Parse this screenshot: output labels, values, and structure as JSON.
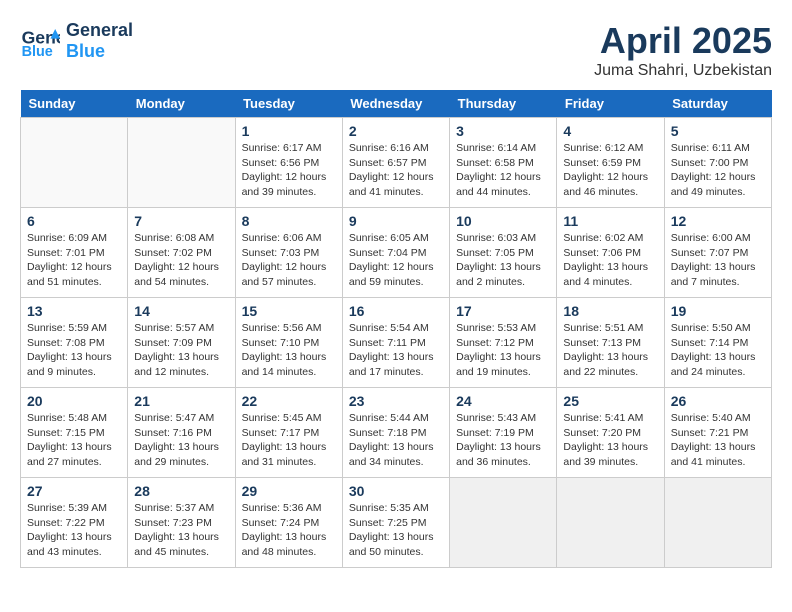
{
  "app": {
    "name": "GeneralBlue"
  },
  "calendar": {
    "month": "April 2025",
    "location": "Juma Shahri, Uzbekistan",
    "weekdays": [
      "Sunday",
      "Monday",
      "Tuesday",
      "Wednesday",
      "Thursday",
      "Friday",
      "Saturday"
    ],
    "weeks": [
      [
        {
          "day": "",
          "info": ""
        },
        {
          "day": "",
          "info": ""
        },
        {
          "day": "1",
          "info": "Sunrise: 6:17 AM\nSunset: 6:56 PM\nDaylight: 12 hours\nand 39 minutes."
        },
        {
          "day": "2",
          "info": "Sunrise: 6:16 AM\nSunset: 6:57 PM\nDaylight: 12 hours\nand 41 minutes."
        },
        {
          "day": "3",
          "info": "Sunrise: 6:14 AM\nSunset: 6:58 PM\nDaylight: 12 hours\nand 44 minutes."
        },
        {
          "day": "4",
          "info": "Sunrise: 6:12 AM\nSunset: 6:59 PM\nDaylight: 12 hours\nand 46 minutes."
        },
        {
          "day": "5",
          "info": "Sunrise: 6:11 AM\nSunset: 7:00 PM\nDaylight: 12 hours\nand 49 minutes."
        }
      ],
      [
        {
          "day": "6",
          "info": "Sunrise: 6:09 AM\nSunset: 7:01 PM\nDaylight: 12 hours\nand 51 minutes."
        },
        {
          "day": "7",
          "info": "Sunrise: 6:08 AM\nSunset: 7:02 PM\nDaylight: 12 hours\nand 54 minutes."
        },
        {
          "day": "8",
          "info": "Sunrise: 6:06 AM\nSunset: 7:03 PM\nDaylight: 12 hours\nand 57 minutes."
        },
        {
          "day": "9",
          "info": "Sunrise: 6:05 AM\nSunset: 7:04 PM\nDaylight: 12 hours\nand 59 minutes."
        },
        {
          "day": "10",
          "info": "Sunrise: 6:03 AM\nSunset: 7:05 PM\nDaylight: 13 hours\nand 2 minutes."
        },
        {
          "day": "11",
          "info": "Sunrise: 6:02 AM\nSunset: 7:06 PM\nDaylight: 13 hours\nand 4 minutes."
        },
        {
          "day": "12",
          "info": "Sunrise: 6:00 AM\nSunset: 7:07 PM\nDaylight: 13 hours\nand 7 minutes."
        }
      ],
      [
        {
          "day": "13",
          "info": "Sunrise: 5:59 AM\nSunset: 7:08 PM\nDaylight: 13 hours\nand 9 minutes."
        },
        {
          "day": "14",
          "info": "Sunrise: 5:57 AM\nSunset: 7:09 PM\nDaylight: 13 hours\nand 12 minutes."
        },
        {
          "day": "15",
          "info": "Sunrise: 5:56 AM\nSunset: 7:10 PM\nDaylight: 13 hours\nand 14 minutes."
        },
        {
          "day": "16",
          "info": "Sunrise: 5:54 AM\nSunset: 7:11 PM\nDaylight: 13 hours\nand 17 minutes."
        },
        {
          "day": "17",
          "info": "Sunrise: 5:53 AM\nSunset: 7:12 PM\nDaylight: 13 hours\nand 19 minutes."
        },
        {
          "day": "18",
          "info": "Sunrise: 5:51 AM\nSunset: 7:13 PM\nDaylight: 13 hours\nand 22 minutes."
        },
        {
          "day": "19",
          "info": "Sunrise: 5:50 AM\nSunset: 7:14 PM\nDaylight: 13 hours\nand 24 minutes."
        }
      ],
      [
        {
          "day": "20",
          "info": "Sunrise: 5:48 AM\nSunset: 7:15 PM\nDaylight: 13 hours\nand 27 minutes."
        },
        {
          "day": "21",
          "info": "Sunrise: 5:47 AM\nSunset: 7:16 PM\nDaylight: 13 hours\nand 29 minutes."
        },
        {
          "day": "22",
          "info": "Sunrise: 5:45 AM\nSunset: 7:17 PM\nDaylight: 13 hours\nand 31 minutes."
        },
        {
          "day": "23",
          "info": "Sunrise: 5:44 AM\nSunset: 7:18 PM\nDaylight: 13 hours\nand 34 minutes."
        },
        {
          "day": "24",
          "info": "Sunrise: 5:43 AM\nSunset: 7:19 PM\nDaylight: 13 hours\nand 36 minutes."
        },
        {
          "day": "25",
          "info": "Sunrise: 5:41 AM\nSunset: 7:20 PM\nDaylight: 13 hours\nand 39 minutes."
        },
        {
          "day": "26",
          "info": "Sunrise: 5:40 AM\nSunset: 7:21 PM\nDaylight: 13 hours\nand 41 minutes."
        }
      ],
      [
        {
          "day": "27",
          "info": "Sunrise: 5:39 AM\nSunset: 7:22 PM\nDaylight: 13 hours\nand 43 minutes."
        },
        {
          "day": "28",
          "info": "Sunrise: 5:37 AM\nSunset: 7:23 PM\nDaylight: 13 hours\nand 45 minutes."
        },
        {
          "day": "29",
          "info": "Sunrise: 5:36 AM\nSunset: 7:24 PM\nDaylight: 13 hours\nand 48 minutes."
        },
        {
          "day": "30",
          "info": "Sunrise: 5:35 AM\nSunset: 7:25 PM\nDaylight: 13 hours\nand 50 minutes."
        },
        {
          "day": "",
          "info": ""
        },
        {
          "day": "",
          "info": ""
        },
        {
          "day": "",
          "info": ""
        }
      ]
    ]
  }
}
